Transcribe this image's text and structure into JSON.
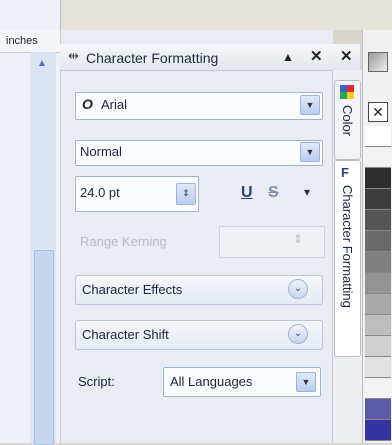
{
  "ruler": {
    "unit": "inches",
    "scroll_up": "▲"
  },
  "docker": {
    "grip": "⇹",
    "title": "Character Formatting",
    "dock_arrow": "▲",
    "close1": "✕",
    "close2": "✕"
  },
  "font": {
    "icon": "O",
    "name": "Arial",
    "dropdown": "▼"
  },
  "style": {
    "value": "Normal",
    "dropdown": "▼"
  },
  "size": {
    "value": "24.0 pt",
    "spin": "⇕"
  },
  "underline": {
    "icon": "U",
    "strike_icon": "S",
    "dropdown": "▾"
  },
  "range_kerning": {
    "label": "Range Kerning",
    "spin": "⇕"
  },
  "rollups": [
    {
      "label": "Character Effects",
      "icon": "⌄"
    },
    {
      "label": "Character Shift",
      "icon": "⌄"
    }
  ],
  "script": {
    "label": "Script:",
    "value": "All Languages",
    "dropdown": "▼"
  },
  "tabs": {
    "color": "Color",
    "character_formatting": "Character Formatting"
  },
  "palette": {
    "swatches": [
      "#ffffff",
      "#f2f2f2",
      "#2d2d2d",
      "#3c3c3c",
      "#555555",
      "#6a6a6a",
      "#7f7f7f",
      "#949494",
      "#a9a9a9",
      "#bdbdbd",
      "#d0d0d0",
      "#e2e2e2",
      "#f3f3f3",
      "#5a5aa6",
      "#3434a0"
    ],
    "none_icon": "✕"
  },
  "colors": {
    "accent": "#9fb3d3",
    "titlebar": "#e3e6ec"
  }
}
